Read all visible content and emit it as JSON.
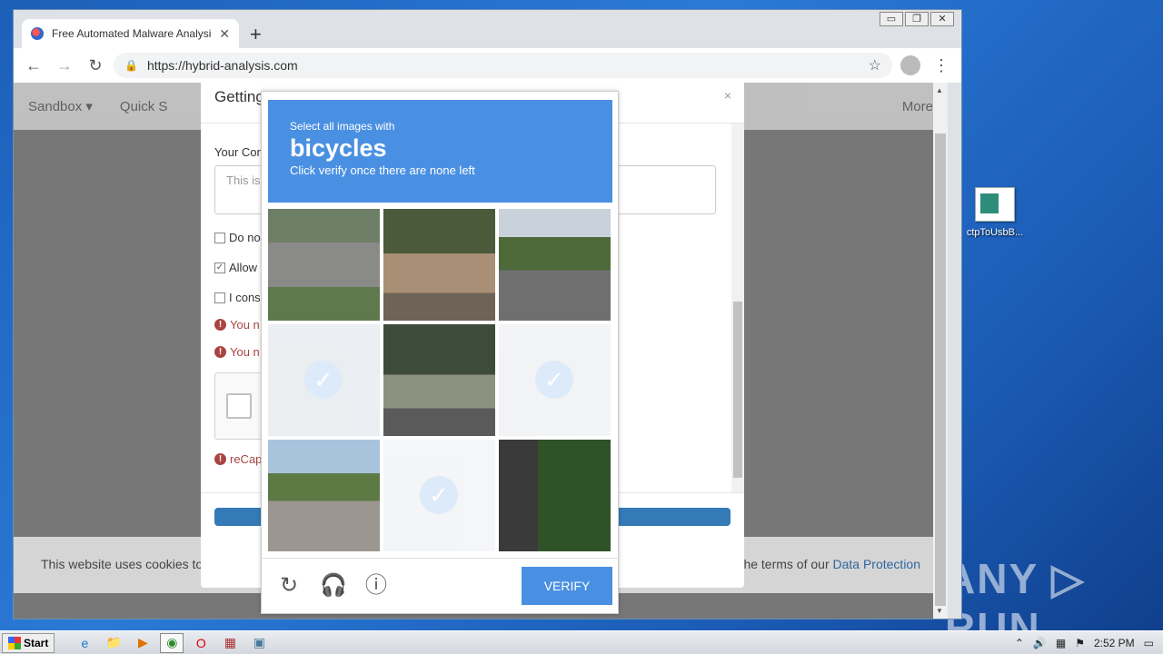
{
  "browser": {
    "tab_title": "Free Automated Malware Analysis Service",
    "new_tab": "+",
    "tab_close": "✕",
    "url": "https://hybrid-analysis.com",
    "window_controls": [
      "▭",
      "❐",
      "✕"
    ]
  },
  "site": {
    "nav": [
      "Sandbox ▾",
      "Quick S"
    ],
    "nav_more": "More",
    "cookie_text_left": "This website uses cookies to",
    "cookie_text_right": "o the terms of our",
    "cookie_link": "Data Protection"
  },
  "modal": {
    "title": "Getting Things Ready",
    "close": "×",
    "comment_label": "Your Con",
    "comment_placeholder": "This is",
    "checkboxes": [
      {
        "label": "Do no",
        "checked": false
      },
      {
        "label": "Allow",
        "checked": true
      },
      {
        "label": "I cons",
        "checked": false
      }
    ],
    "errors": [
      "You n",
      "You n"
    ],
    "recaptcha_error": "reCap"
  },
  "captcha": {
    "prompt_line1": "Select all images with",
    "prompt_target": "bicycles",
    "prompt_line3": "Click verify once there are none left",
    "verify_label": "VERIFY",
    "icons": [
      "reload-icon",
      "audio-icon",
      "info-icon"
    ],
    "tiles": [
      {
        "id": 1,
        "selected": false
      },
      {
        "id": 2,
        "selected": false
      },
      {
        "id": 3,
        "selected": false
      },
      {
        "id": 4,
        "selected": true
      },
      {
        "id": 5,
        "selected": false
      },
      {
        "id": 6,
        "selected": true
      },
      {
        "id": 7,
        "selected": false
      },
      {
        "id": 8,
        "selected": true
      },
      {
        "id": 9,
        "selected": false
      }
    ]
  },
  "desktop": {
    "icon_label": "ctpToUsbB...",
    "watermark": "ANY ▷ RUN"
  },
  "taskbar": {
    "start_label": "Start",
    "clock": "2:52 PM"
  }
}
